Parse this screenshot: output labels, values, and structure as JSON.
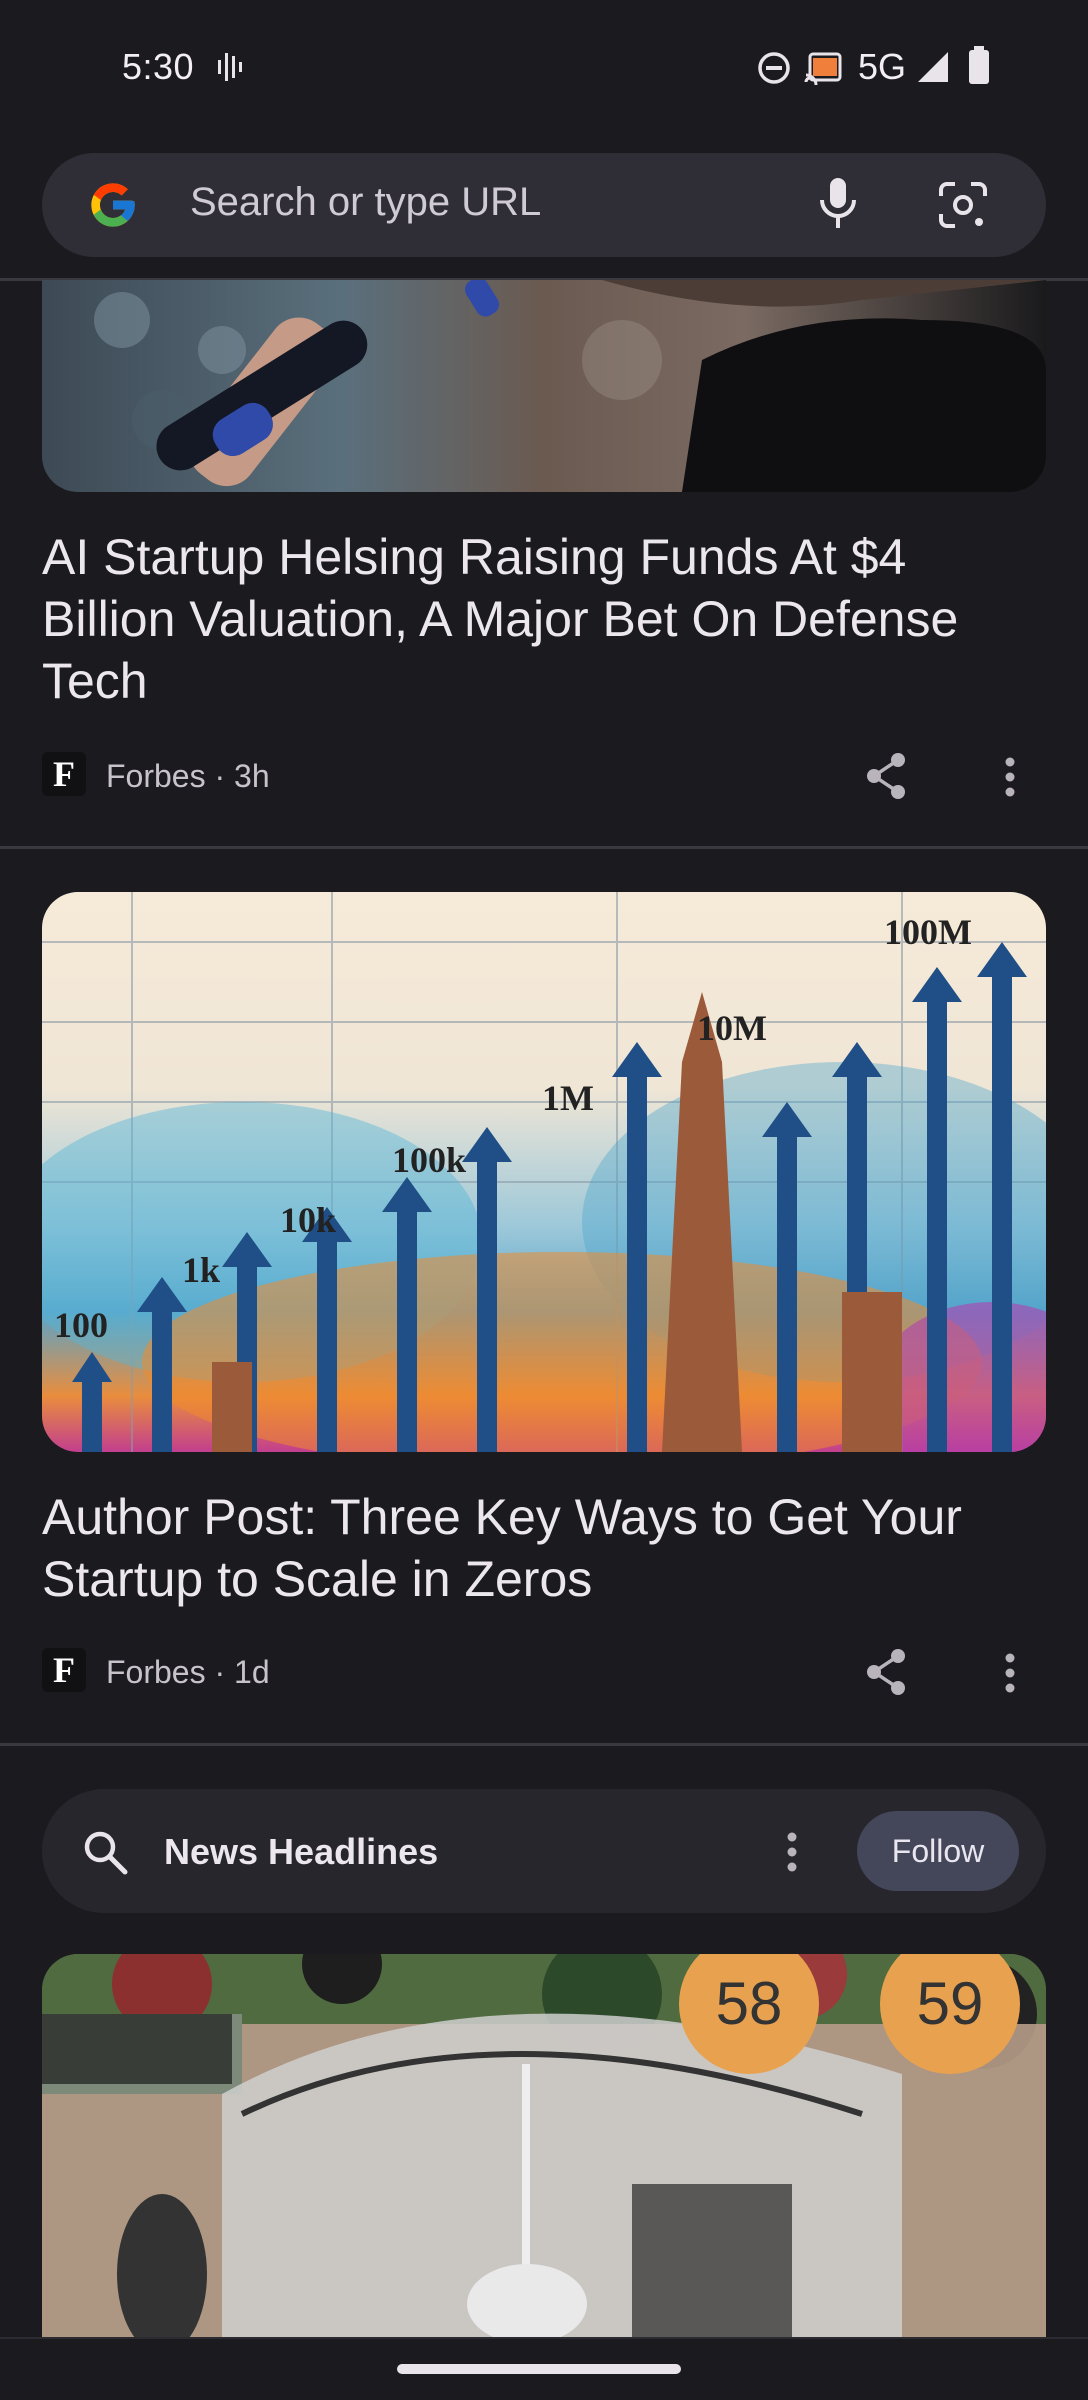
{
  "status": {
    "time": "5:30",
    "network": "5G"
  },
  "search": {
    "placeholder": "Search or type URL"
  },
  "articles": [
    {
      "headline": "AI Startup Helsing Raising Funds At $4 Billion Valuation, A Major Bet On Defense Tech",
      "source": "Forbes · 3h",
      "logo": "F"
    },
    {
      "headline": "Author Post: Three Key Ways to Get Your Startup to Scale in Zeros",
      "source": "Forbes · 1d",
      "logo": "F",
      "image_labels": [
        "100",
        "1k",
        "10k",
        "100k",
        "1M",
        "10M",
        "100M"
      ]
    },
    {
      "image_labels": [
        "58",
        "59"
      ]
    }
  ],
  "topic": {
    "label": "News Headlines",
    "follow_label": "Follow"
  },
  "colors": {
    "background": "#1b1b1f",
    "search_bar": "#2f2e36",
    "follow_button": "#44475a"
  }
}
